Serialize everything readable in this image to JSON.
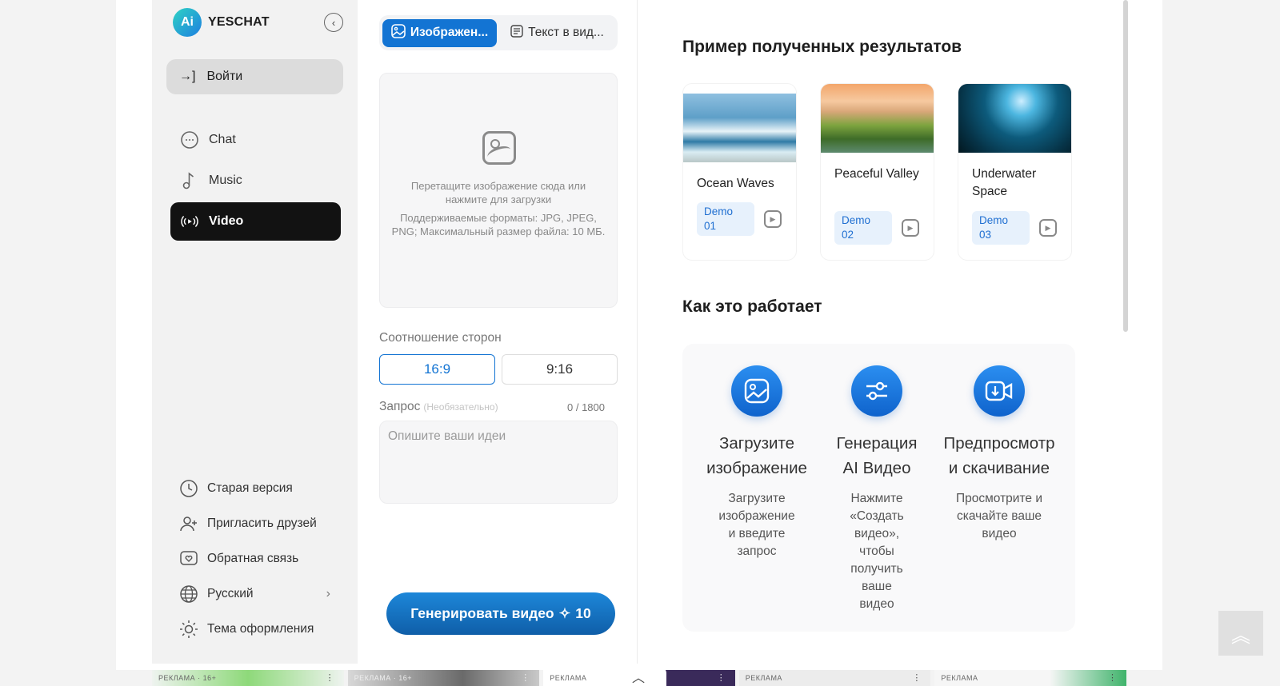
{
  "brand": {
    "name": "YESCHAT",
    "logo_text": "Ai"
  },
  "sidebar": {
    "login_label": "Войти",
    "nav": [
      {
        "label": "Chat",
        "icon": "chat-bubble-icon"
      },
      {
        "label": "Music",
        "icon": "music-note-icon"
      },
      {
        "label": "Video",
        "icon": "video-broadcast-icon",
        "active": true
      }
    ],
    "bottom": [
      {
        "label": "Старая версия",
        "icon": "clock-icon"
      },
      {
        "label": "Пригласить друзей",
        "icon": "user-plus-icon"
      },
      {
        "label": "Обратная связь",
        "icon": "heart-message-icon"
      },
      {
        "label": "Русский",
        "icon": "globe-icon"
      },
      {
        "label": "Тема оформления",
        "icon": "sun-icon"
      }
    ]
  },
  "tabs": [
    {
      "label": "Изображен...",
      "active": true
    },
    {
      "label": "Текст в вид..."
    }
  ],
  "upload": {
    "text": "Перетащите изображение сюда или нажмите для загрузки",
    "sub": "Поддерживаемые форматы: JPG, JPEG, PNG; Максимальный размер файла: 10 МБ."
  },
  "aspect": {
    "label": "Соотношение сторон",
    "options": [
      "16:9",
      "9:16"
    ],
    "selected": "16:9"
  },
  "prompt": {
    "label": "Запрос",
    "optional": "(Необязательно)",
    "counter": "0 / 1800",
    "placeholder": "Опишите ваши идеи",
    "value": ""
  },
  "generate": {
    "label": "Генерировать видео",
    "cost": "10",
    "sparkle": "✧"
  },
  "results": {
    "title": "Пример полученных результатов",
    "cards": [
      {
        "title": "Ocean Waves",
        "tag": "Demo 01"
      },
      {
        "title": "Peaceful Valley",
        "tag": "Demo 02"
      },
      {
        "title": "Underwater Space",
        "tag": "Demo 03"
      }
    ]
  },
  "how": {
    "title": "Как это работает",
    "steps": [
      {
        "title": "Загрузите изображение",
        "desc": "Загрузите изображение и введите запрос"
      },
      {
        "title": "Генерация AI Видео",
        "desc": "Нажмите «Создать видео», чтобы получить ваше видео"
      },
      {
        "title": "Предпросмотр и скачивание",
        "desc": "Просмотрите и скачайте ваше видео"
      }
    ]
  },
  "ads": [
    {
      "label": "РЕКЛАМА · 16+"
    },
    {
      "label": "РЕКЛАМА · 16+"
    },
    {
      "label": "РЕКЛАМА"
    },
    {
      "label": "РЕКЛАМА"
    },
    {
      "label": "РЕКЛАМА"
    }
  ]
}
